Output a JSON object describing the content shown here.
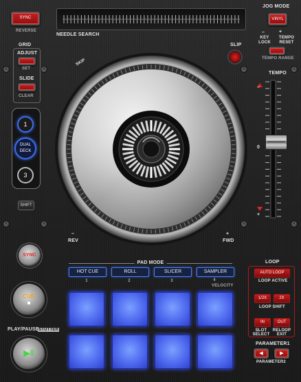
{
  "top": {
    "sync_button": "SYNC",
    "reverse_label": "REVERSE",
    "needle_search_label": "NEEDLE SEARCH",
    "jog_mode_label": "JOG MODE",
    "vinyl_button": "VINYL",
    "key_lock_label": "KEY LOCK",
    "tempo_reset_label": "TEMPO RESET",
    "tempo_range_label": "TEMPO RANGE",
    "minus_sign": "–",
    "plus_sign": "+"
  },
  "left": {
    "grid_label": "GRID",
    "adjust_label": "ADJUST",
    "set_label": "SET",
    "slide_label": "SLIDE",
    "clear_label": "CLEAR",
    "deck1": "1",
    "dual_deck": "DUAL DECK",
    "deck3": "3",
    "shift_label": "SHIFT"
  },
  "jog": {
    "skip_label": "SKIP",
    "slip_label": "SLIP",
    "rev_label": "REV",
    "fwd_label": "FWD",
    "minus": "–",
    "plus": "+"
  },
  "tempo": {
    "label": "TEMPO",
    "zero_mark": "0",
    "minus_mark": "–",
    "plus_mark": "+"
  },
  "transport": {
    "sync_label": "SYNC",
    "cue_label": "CUE",
    "play_pause_label": "PLAY/PAUSE",
    "stutter_label": "STUTTER"
  },
  "pad_mode": {
    "label": "PAD MODE",
    "modes": [
      "HOT CUE",
      "ROLL",
      "SLICER",
      "SAMPLER"
    ],
    "numbers": [
      "1",
      "2",
      "3",
      "4"
    ],
    "velocity_label": "VELOCITY"
  },
  "loop": {
    "label": "LOOP",
    "auto_loop": "AUTO LOOP",
    "loop_active": "LOOP ACTIVE",
    "half_button": "1/2X",
    "double_button": "2X",
    "loop_shift": "LOOP SHIFT",
    "in_button": "IN",
    "out_button": "OUT",
    "slot_select": "SLOT SELECT",
    "reloop_exit": "RELOOP EXIT"
  },
  "parameter": {
    "label1": "PARAMETER1",
    "label2": "PARAMETER2"
  },
  "colors": {
    "accent_red": "#e02424",
    "pad_blue": "#4d68ee",
    "panel_dark": "#202021"
  }
}
